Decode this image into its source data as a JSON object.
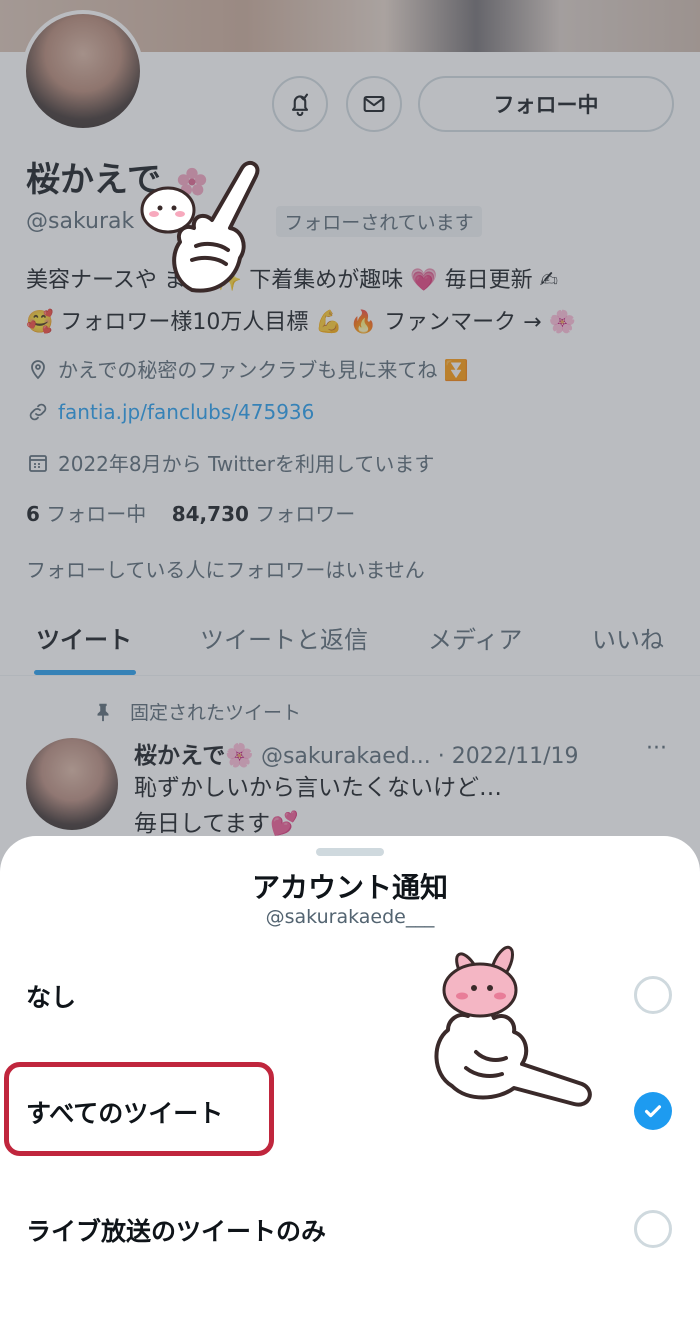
{
  "profile": {
    "name": "桜かえで",
    "handle": "@sakurak",
    "follows_you": "フォローされています",
    "follow_button": "フォロー中",
    "bio_line1": "美容ナースや ます ✨ 下着集めが趣味 💗 毎日更新 ✍",
    "bio_line2": "🥰 フォロワー様10万人目標 💪 🔥 ファンマーク → 🌸",
    "location": "かえでの秘密のファンクラブも見に来てね ⏬",
    "website": "fantia.jp/fanclubs/475936",
    "joined": "2022年8月から Twitterを利用しています",
    "following_count": "6",
    "following_label": "フォロー中",
    "followers_count": "84,730",
    "followers_label": "フォロワー",
    "no_mutual": "フォローしている人にフォロワーはいません"
  },
  "tabs": [
    "ツイート",
    "ツイートと返信",
    "メディア",
    "いいね"
  ],
  "pinned_tweet": {
    "pinned_label": "固定されたツイート",
    "author": "桜かえで🌸",
    "handle_date": "@sakurakaed... · 2022/11/19",
    "more": "···",
    "line1": "恥ずかしいから言いたくないけど…",
    "line2": "毎日してます💕"
  },
  "sheet": {
    "title": "アカウント通知",
    "subtitle": "@sakurakaede___",
    "options": [
      {
        "label": "なし",
        "selected": false
      },
      {
        "label": "すべてのツイート",
        "selected": true
      },
      {
        "label": "ライブ放送のツイートのみ",
        "selected": false
      }
    ]
  },
  "colors": {
    "accent": "#1d9bf0",
    "highlight": "#c0263d",
    "text_secondary": "#536471"
  },
  "icons": [
    "bell-check-icon",
    "mail-icon",
    "location-pin-icon",
    "link-icon",
    "calendar-icon",
    "pin-icon",
    "check-icon",
    "pointing-hand-sticker"
  ]
}
